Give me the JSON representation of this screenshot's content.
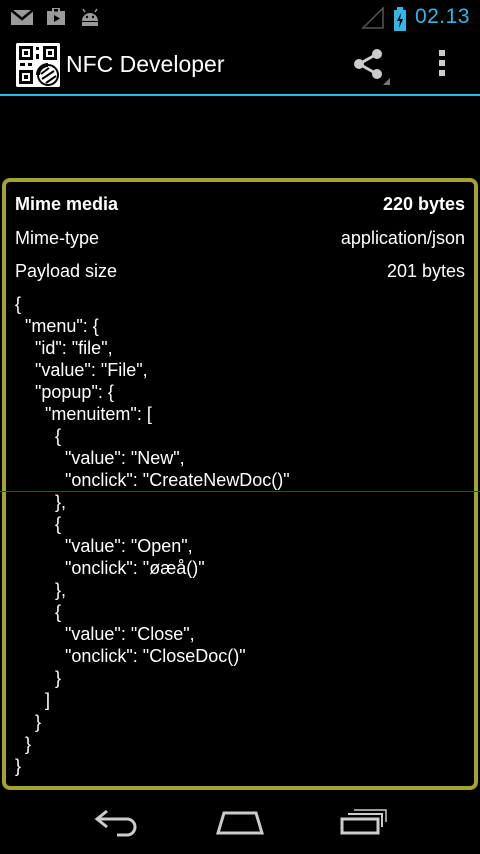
{
  "status_bar": {
    "time": "02.13",
    "icons": [
      "gmail-icon",
      "play-store-icon",
      "android-icon",
      "signal-icon",
      "battery-charging-icon"
    ],
    "accent": "#33b5e5"
  },
  "action_bar": {
    "title": "NFC Developer",
    "icons": [
      "qr-app-icon",
      "share-icon",
      "overflow-menu-icon"
    ]
  },
  "record": {
    "header_label": "Mime media",
    "header_value": "220 bytes",
    "mime_type_label": "Mime-type",
    "mime_type_value": "application/json",
    "payload_size_label": "Payload size",
    "payload_size_value": "201 bytes",
    "payload": "{\n  \"menu\": {\n    \"id\": \"file\",\n    \"value\": \"File\",\n    \"popup\": {\n      \"menuitem\": [\n        {\n          \"value\": \"New\",\n          \"onclick\": \"CreateNewDoc()\"\n        },\n        {\n          \"value\": \"Open\",\n          \"onclick\": \"øæå()\"\n        },\n        {\n          \"value\": \"Close\",\n          \"onclick\": \"CloseDoc()\"\n        }\n      ]\n    }\n  }\n}",
    "border_color": "#a3a332"
  },
  "nav_bar": {
    "icons": [
      "back-icon",
      "home-icon",
      "recent-apps-icon"
    ]
  }
}
